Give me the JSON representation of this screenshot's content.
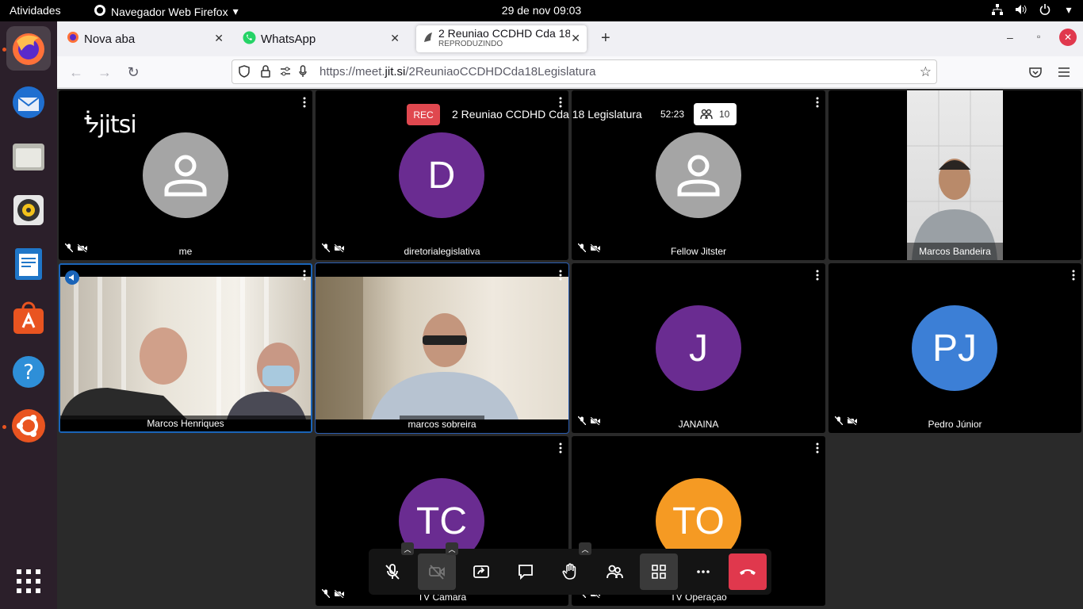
{
  "topbar": {
    "activities": "Atividades",
    "app_name": "Navegador Web Firefox",
    "clock": "29 de nov  09:03"
  },
  "dock": {
    "items": [
      "firefox-icon",
      "thunderbird-icon",
      "files-icon",
      "rhythmbox-icon",
      "libreoffice-writer-icon",
      "software-store-icon",
      "help-icon",
      "ubuntu-icon",
      "show-apps-icon"
    ]
  },
  "browser": {
    "tabs": [
      {
        "title": "Nova aba"
      },
      {
        "title": "WhatsApp"
      },
      {
        "title": "2 Reuniao CCDHD Cda 18",
        "subtitle": "REPRODUZINDO"
      }
    ],
    "url_prefix": "https://meet.",
    "url_domain": "jit.si",
    "url_path": "/2ReuniaoCCDHDCda18Legislatura"
  },
  "meeting": {
    "rec_label": "REC",
    "title": "2 Reuniao CCDHD Cda 18 Legislatura",
    "elapsed": "52:23",
    "participant_count": "10",
    "logo": "jitsi"
  },
  "participants": [
    {
      "name": "me",
      "initials": ""
    },
    {
      "name": "diretorialegislativa",
      "initials": "D"
    },
    {
      "name": "Fellow Jitster",
      "initials": ""
    },
    {
      "name": "Marcos Bandeira",
      "initials": ""
    },
    {
      "name": "Marcos Henriques",
      "initials": ""
    },
    {
      "name": "marcos sobreira",
      "initials": ""
    },
    {
      "name": "JANAINA",
      "initials": "J"
    },
    {
      "name": "Pedro Júnior",
      "initials": "PJ"
    },
    {
      "name": "TV Câmara",
      "initials": "TC"
    },
    {
      "name": "TV Operação",
      "initials": "TO"
    }
  ],
  "colors": {
    "avatar_purple": "#6a2c91",
    "avatar_blue": "#3c7fd6",
    "avatar_orange": "#f59a23",
    "hangup_red": "#e0384d",
    "ubuntu_orange": "#e95420"
  }
}
